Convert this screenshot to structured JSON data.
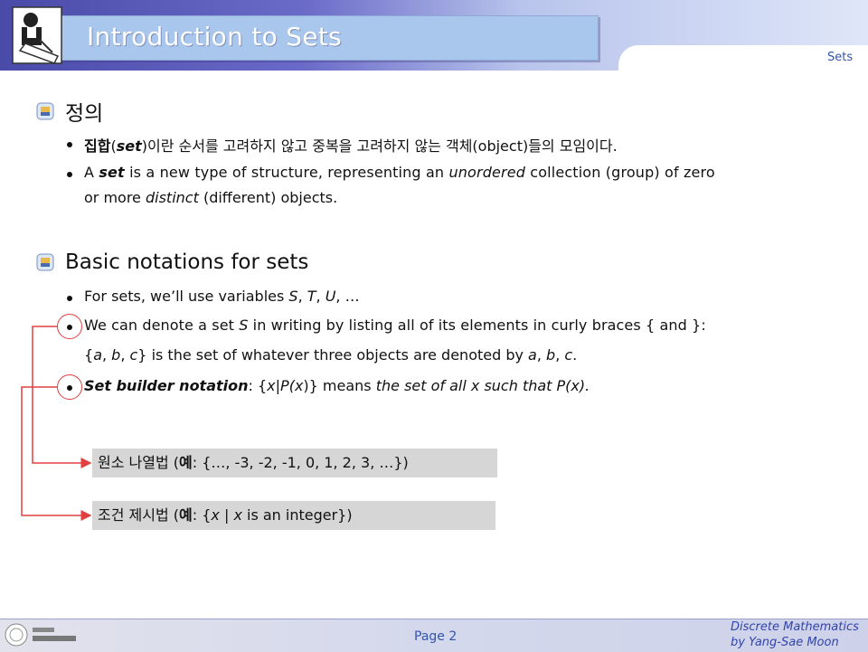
{
  "header": {
    "title": "Introduction to Sets",
    "tag": "Sets"
  },
  "sections": [
    {
      "heading": "정의",
      "bullets": [
        {
          "parts": [
            "집합",
            "(",
            "set",
            ")이란 순서를 고려하지 않고 중복을 고려하지 않는 객체(object)들의 모임이다."
          ]
        },
        {
          "line1": [
            "A ",
            "set",
            " is a new type of structure, representing an ",
            "unordered",
            " collection  (group) of zero"
          ],
          "line2": [
            "or more ",
            "distinct",
            " (different) objects."
          ]
        }
      ]
    },
    {
      "heading": "Basic notations for sets",
      "bullets": [
        {
          "parts": [
            "For sets, we’ll use variables ",
            "S",
            ", ",
            "T",
            ", ",
            "U",
            ", …"
          ]
        },
        {
          "line1": [
            "We can denote a set ",
            "S",
            " in writing by listing all of its elements in curly braces { and }:"
          ],
          "line2": [
            "{",
            "a",
            ", ",
            "b",
            ", ",
            "c",
            "} is the set of whatever three objects are denoted by ",
            "a",
            ", ",
            "b",
            ", ",
            "c",
            "."
          ]
        },
        {
          "parts": [
            "Set builder notation",
            ": {",
            "x",
            "|",
            "P",
            "(",
            "x",
            ")} means ",
            "the set of all x such that P",
            "(",
            "x",
            ")."
          ]
        }
      ]
    }
  ],
  "examples": {
    "roster": [
      "원소 나열법 (",
      "예",
      ": {…, -3, -2, -1, 0, 1, 2, 3, …})"
    ],
    "builder": [
      "조건 제시법 (",
      "예",
      ": {",
      "x",
      " | ",
      "x",
      " is an integer})"
    ]
  },
  "footer": {
    "page": "Page 2",
    "credit_line1": "Discrete Mathematics",
    "credit_line2": "by Yang-Sae Moon"
  },
  "colors": {
    "header_dark": "#4a4aa8",
    "title_box": "#a9c6ec",
    "arrow_red": "#e04040",
    "footer_text": "#3355aa"
  }
}
